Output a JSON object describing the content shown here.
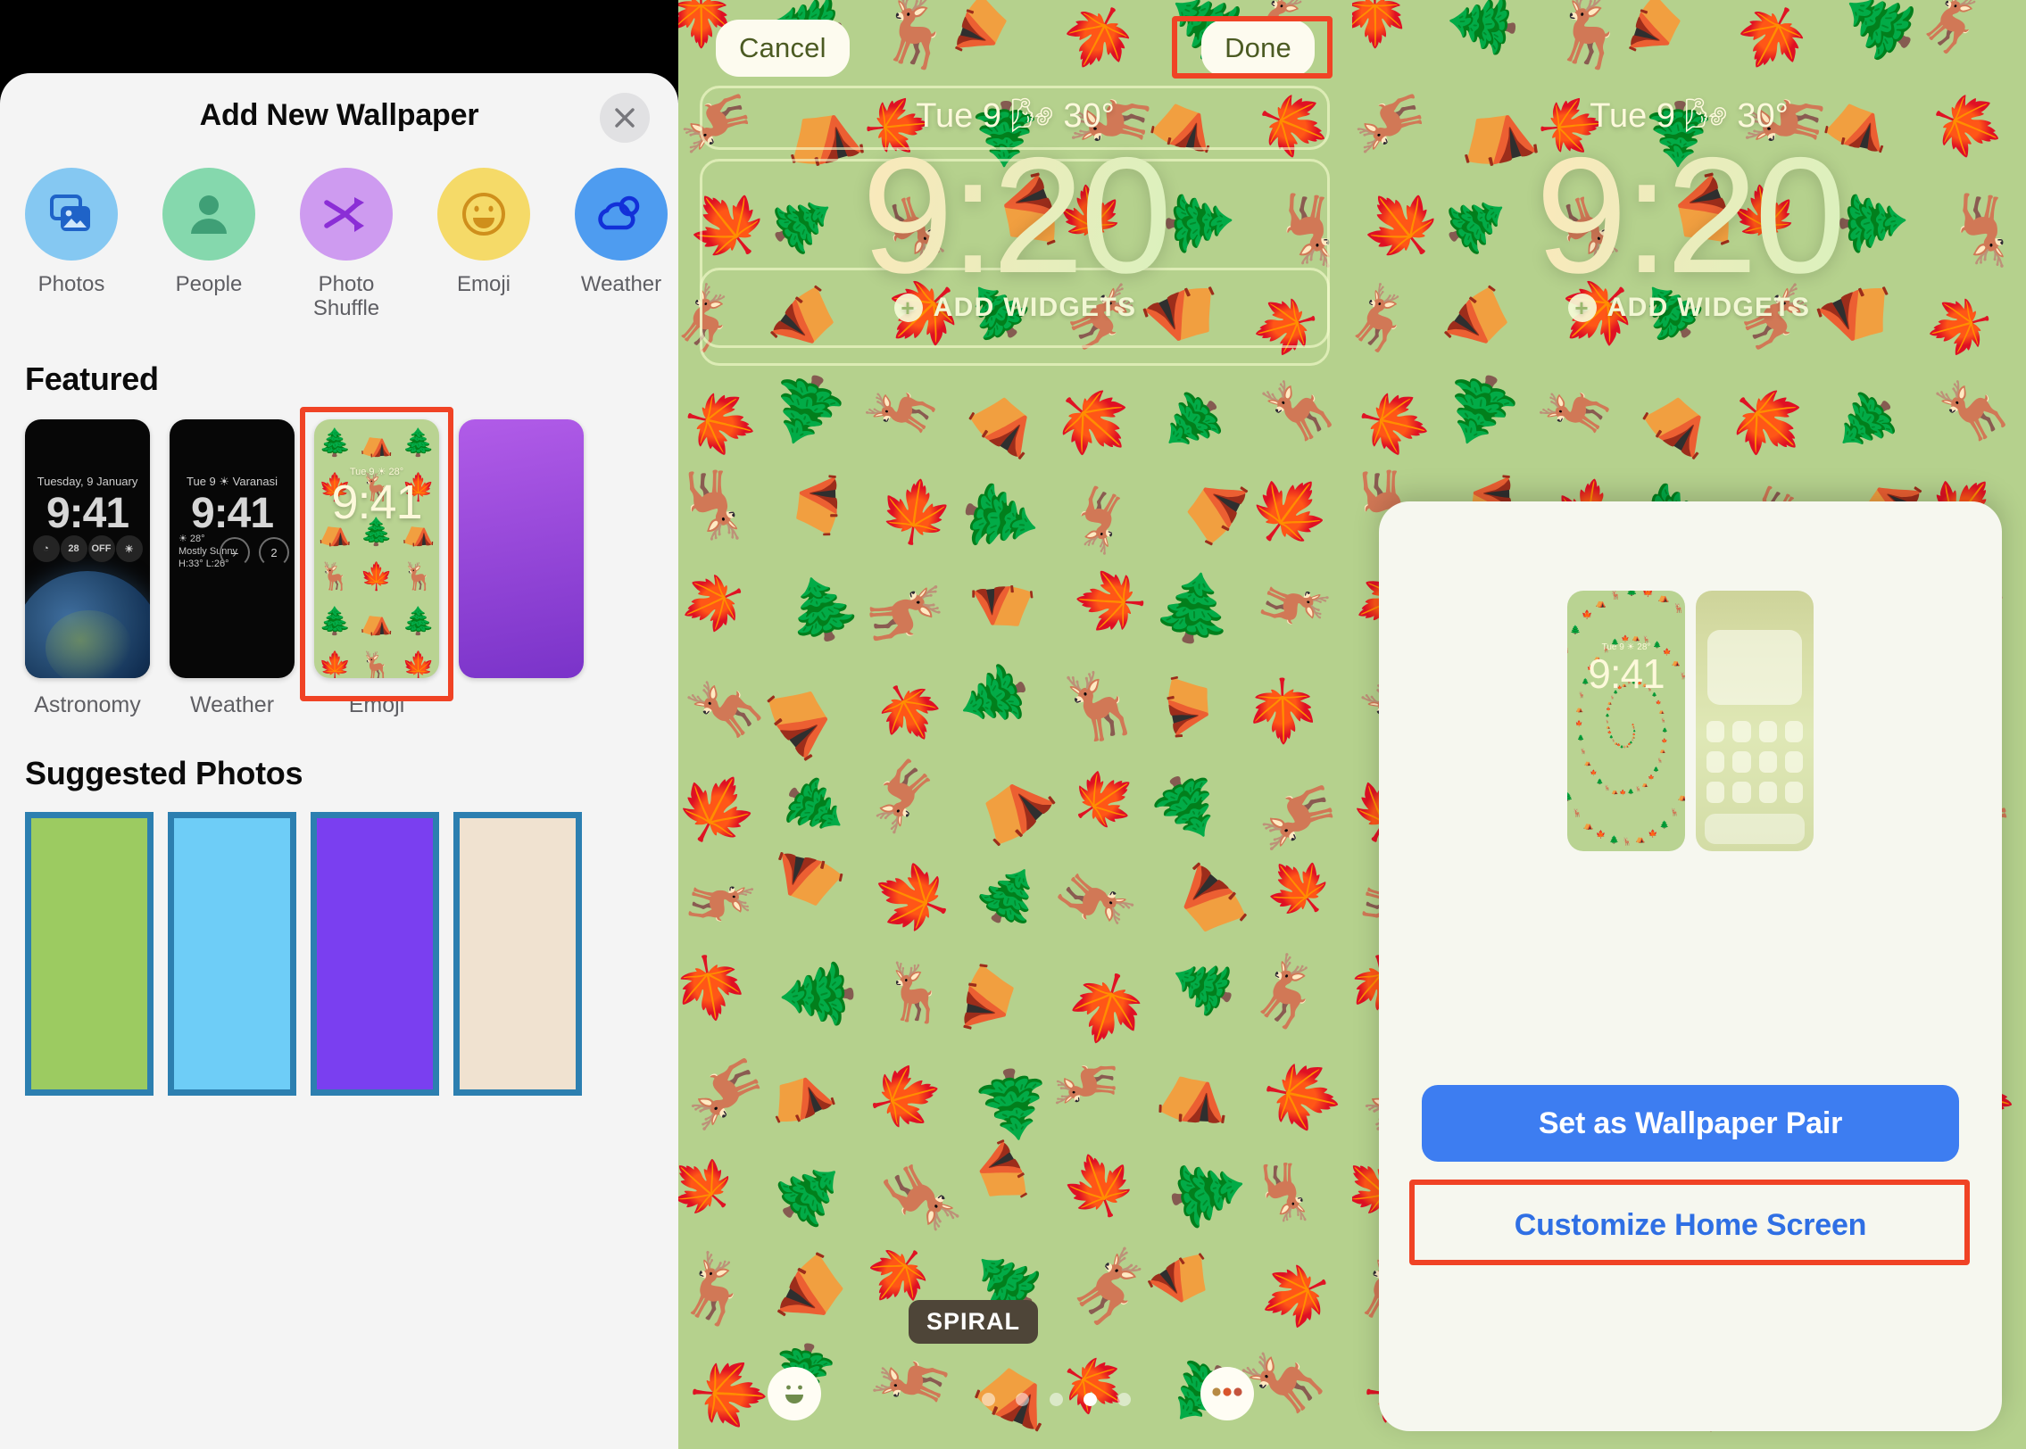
{
  "panel_add_wallpaper": {
    "title": "Add New Wallpaper",
    "close_icon": "close-icon",
    "categories": [
      {
        "label": "Photos",
        "icon": "photos-icon",
        "circle_color": "#85c8f2",
        "glyph_color": "#1f63c8"
      },
      {
        "label": "People",
        "icon": "people-icon",
        "circle_color": "#85d8ad",
        "glyph_color": "#3f9f76"
      },
      {
        "label": "Photo Shuffle",
        "icon": "shuffle-icon",
        "circle_color": "#ce9bf0",
        "glyph_color": "#8b2ed6"
      },
      {
        "label": "Emoji",
        "icon": "emoji-smiley-icon",
        "circle_color": "#f5da68",
        "glyph_color": "#cf8f1c"
      },
      {
        "label": "Weather",
        "icon": "weather-cloud-icon",
        "circle_color": "#4e9cf0",
        "glyph_color": "#1230d8"
      }
    ],
    "featured": {
      "heading": "Featured",
      "items": [
        {
          "name": "Astronomy",
          "date": "Tuesday, 9 January",
          "time": "9:41",
          "complications": [
            "◔",
            "28",
            "OFF",
            "☀"
          ]
        },
        {
          "name": "Weather",
          "date": "Tue 9  ☀ Varanasi",
          "time": "9:41",
          "temp": "☀ 28°",
          "condition": "Mostly Sunny",
          "range": "H:33° L:26°",
          "gauges": [
            "--",
            "2"
          ]
        },
        {
          "name": "Emoji",
          "date": "Tue 9  ☀ 28°",
          "time": "9:41",
          "emojis": [
            "🌲",
            "⛺",
            "🌲",
            "🍁",
            "🦌",
            "🍁",
            "⛺",
            "🌲",
            "⛺",
            "🦌",
            "🍁",
            "🦌",
            "🌲",
            "⛺",
            "🌲",
            "🍁",
            "🦌",
            "🍁",
            "⛺",
            "🌲",
            "⛺",
            "🦌",
            "🍁",
            "🦌"
          ],
          "highlighted": true
        }
      ]
    },
    "suggested": {
      "heading": "Suggested Photos",
      "items": [
        {
          "color": "#9ccb61",
          "border": "#2c7fb0"
        },
        {
          "color": "#6ecdf7",
          "border": "#2c7fb0"
        },
        {
          "color": "#7a3ff0",
          "border": "#2c7fb0"
        }
      ]
    }
  },
  "panel_preview": {
    "cancel_label": "Cancel",
    "done_label": "Done",
    "done_highlighted": true,
    "date_line": "Tue 9  🌬 30°",
    "time": "9:20",
    "add_widgets_label": "ADD WIDGETS",
    "add_widgets_icon": "plus-circle-icon",
    "style_chip": "SPIRAL",
    "emoji_button_icon": "emoji-smiley-icon",
    "more_button_icon": "more-options-icon",
    "page_dots": {
      "count": 5,
      "active_index": 3
    },
    "wallpaper_color": "#b5d18d"
  },
  "panel_pair": {
    "date_line": "Tue 9  🌬 30°",
    "time": "9:20",
    "add_widgets_label": "ADD WIDGETS",
    "dialog": {
      "lock_preview": {
        "date": "Tue 9  ☀ 28°",
        "time": "9:41"
      },
      "home_preview": {
        "label": "home-screen-preview"
      },
      "primary_button": "Set as Wallpaper Pair",
      "link_button": "Customize Home Screen",
      "link_highlighted": true,
      "primary_color": "#3d7df1",
      "link_color": "#2f6fe4"
    }
  },
  "annotations": {
    "highlight_color": "#f04325"
  }
}
